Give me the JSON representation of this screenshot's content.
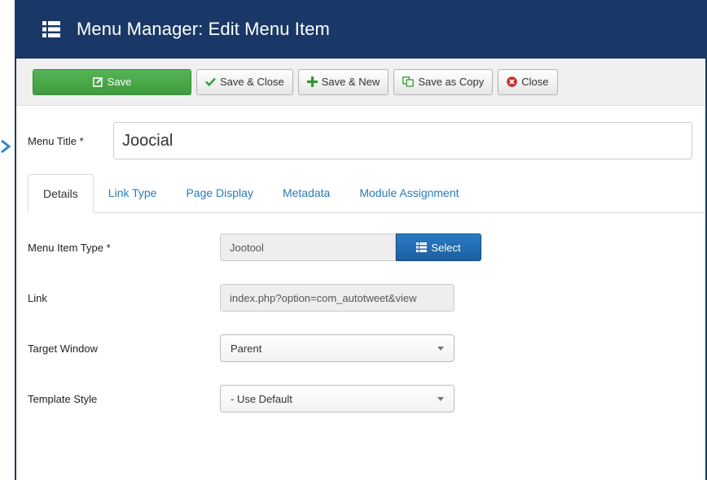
{
  "header": {
    "title": "Menu Manager: Edit Menu Item",
    "icon": "list-icon"
  },
  "toolbar": {
    "save_label": "Save",
    "save_close_label": "Save & Close",
    "save_new_label": "Save & New",
    "save_copy_label": "Save as Copy",
    "close_label": "Close"
  },
  "form": {
    "menu_title_label": "Menu Title *",
    "menu_title_value": "Joocial"
  },
  "tabs": [
    "Details",
    "Link Type",
    "Page Display",
    "Metadata",
    "Module Assignment"
  ],
  "details": {
    "menu_item_type_label": "Menu Item Type *",
    "menu_item_type_value": "Jootool",
    "select_label": "Select",
    "link_label": "Link",
    "link_value": "index.php?option=com_autotweet&view",
    "target_window_label": "Target Window",
    "target_window_value": "Parent",
    "template_style_label": "Template Style",
    "template_style_value": "- Use Default"
  },
  "colors": {
    "header_bg": "#1a3867",
    "save_green": "#46a546",
    "select_blue": "#2a7bc4",
    "tab_link": "#2a7ab5"
  }
}
